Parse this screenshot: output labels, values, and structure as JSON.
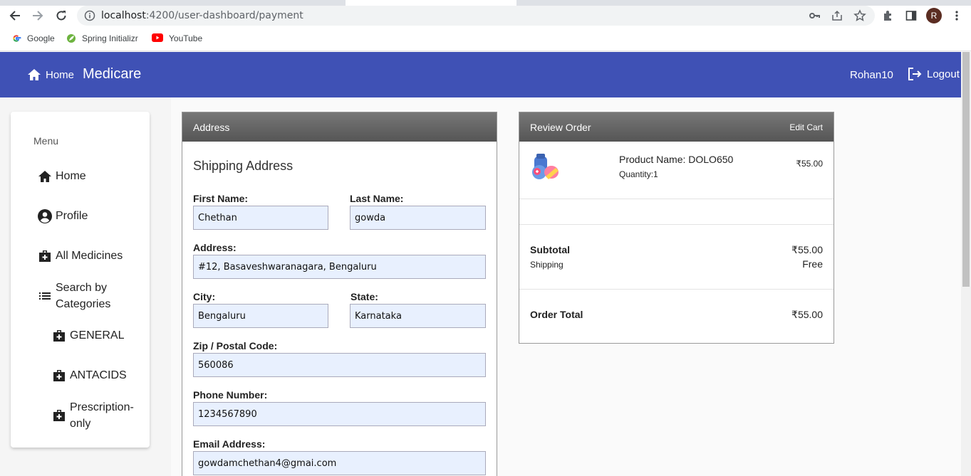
{
  "browser": {
    "url_host": "localhost",
    "url_path": ":4200/user-dashboard/payment",
    "avatar_letter": "R",
    "bookmarks": [
      {
        "label": "Google"
      },
      {
        "label": "Spring Initializr"
      },
      {
        "label": "YouTube"
      }
    ]
  },
  "appbar": {
    "home_label": "Home",
    "brand": "Medicare",
    "username": "Rohan10",
    "logout_label": "Logout",
    "color": "#3f51b5"
  },
  "sidebar": {
    "menu_label": "Menu",
    "items": [
      {
        "label": "Home",
        "icon": "home-icon"
      },
      {
        "label": "Profile",
        "icon": "account-circle-icon"
      },
      {
        "label": "All Medicines",
        "icon": "medical-bag-icon"
      },
      {
        "label_line1": "Search by",
        "label_line2": "Categories",
        "icon": "list-icon"
      },
      {
        "label": "GENERAL",
        "icon": "medical-bag-icon"
      },
      {
        "label": "ANTACIDS",
        "icon": "medical-bag-icon"
      },
      {
        "label_line1": "Prescription-",
        "label_line2": "only",
        "icon": "medical-bag-icon"
      }
    ]
  },
  "address": {
    "header": "Address",
    "title": "Shipping Address",
    "first_name_label": "First Name:",
    "first_name": "Chethan",
    "last_name_label": "Last Name:",
    "last_name": "gowda",
    "address_label": "Address:",
    "address": "#12, Basaveshwaranagara, Bengaluru",
    "city_label": "City:",
    "city": "Bengaluru",
    "state_label": "State:",
    "state": "Karnataka",
    "zip_label": "Zip / Postal Code:",
    "zip": "560086",
    "phone_label": "Phone Number:",
    "phone": "1234567890",
    "email_label": "Email Address:",
    "email": "gowdamchethan4@gmai.com"
  },
  "review": {
    "header": "Review Order",
    "edit_cart": "Edit Cart",
    "product_name": "Product Name: DOLO650",
    "quantity": "Quantity:1",
    "price": "₹55.00",
    "subtotal_label": "Subtotal",
    "subtotal": "₹55.00",
    "shipping_label": "Shipping",
    "shipping": "Free",
    "order_total_label": "Order Total",
    "order_total": "₹55.00"
  }
}
